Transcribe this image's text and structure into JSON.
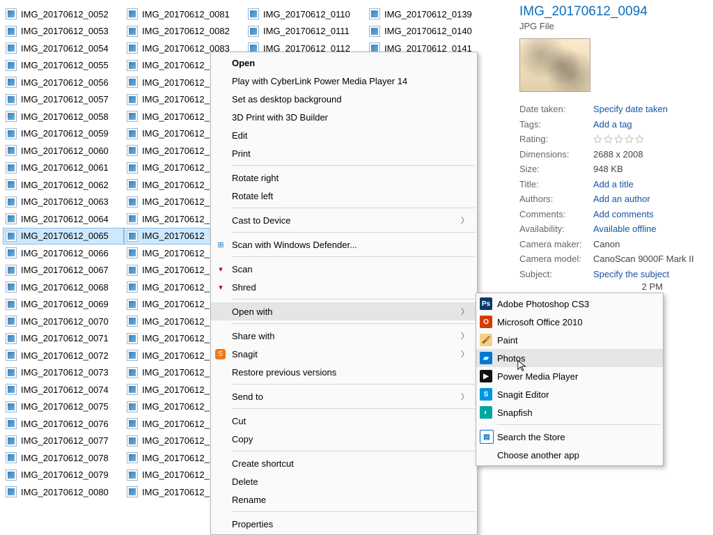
{
  "files": {
    "col1": [
      "IMG_20170612_0052",
      "IMG_20170612_0053",
      "IMG_20170612_0054",
      "IMG_20170612_0055",
      "IMG_20170612_0056",
      "IMG_20170612_0057",
      "IMG_20170612_0058",
      "IMG_20170612_0059",
      "IMG_20170612_0060",
      "IMG_20170612_0061",
      "IMG_20170612_0062",
      "IMG_20170612_0063",
      "IMG_20170612_0064",
      "IMG_20170612_0065",
      "IMG_20170612_0066",
      "IMG_20170612_0067",
      "IMG_20170612_0068",
      "IMG_20170612_0069",
      "IMG_20170612_0070",
      "IMG_20170612_0071",
      "IMG_20170612_0072",
      "IMG_20170612_0073",
      "IMG_20170612_0074",
      "IMG_20170612_0075",
      "IMG_20170612_0076",
      "IMG_20170612_0077",
      "IMG_20170612_0078",
      "IMG_20170612_0079",
      "IMG_20170612_0080"
    ],
    "col2_full": [
      "IMG_20170612_0081",
      "IMG_20170612_0082",
      "IMG_20170612_0083"
    ],
    "col2_trunc": [
      "IMG_20170612_",
      "IMG_20170612_",
      "IMG_20170612_",
      "IMG_20170612_",
      "IMG_20170612_",
      "IMG_20170612_",
      "IMG_20170612_",
      "IMG_20170612_",
      "IMG_20170612_",
      "IMG_20170612_",
      "IMG_20170612",
      "IMG_20170612_",
      "IMG_20170612_",
      "IMG_20170612_",
      "IMG_20170612_",
      "IMG_20170612_",
      "IMG_20170612_",
      "IMG_20170612_",
      "IMG_20170612_",
      "IMG_20170612_",
      "IMG_20170612_",
      "IMG_20170612_",
      "IMG_20170612_",
      "IMG_20170612_",
      "IMG_20170612_",
      "IMG_20170612_"
    ],
    "col3": [
      "IMG_20170612_0110",
      "IMG_20170612_0111",
      "IMG_20170612_0112"
    ],
    "col4": [
      "IMG_20170612_0139",
      "IMG_20170612_0140",
      "IMG_20170612_0141"
    ]
  },
  "selected_file_name": "IMG_20170612_0094",
  "details": {
    "title": "IMG_20170612_0094",
    "type": "JPG File",
    "rows": [
      {
        "label": "Date taken:",
        "value": "Specify date taken",
        "link": true
      },
      {
        "label": "Tags:",
        "value": "Add a tag",
        "link": true
      },
      {
        "label": "Rating:",
        "value": "",
        "stars": true
      },
      {
        "label": "Dimensions:",
        "value": "2688 x 2008"
      },
      {
        "label": "Size:",
        "value": "948 KB"
      },
      {
        "label": "Title:",
        "value": "Add a title",
        "link": true
      },
      {
        "label": "Authors:",
        "value": "Add an author",
        "link": true
      },
      {
        "label": "Comments:",
        "value": "Add comments",
        "link": true
      },
      {
        "label": "Availability:",
        "value": "Available offline",
        "link": true
      },
      {
        "label": "Camera maker:",
        "value": "Canon"
      },
      {
        "label": "Camera model:",
        "value": "CanoScan 9000F Mark II"
      },
      {
        "label": "Subject:",
        "value": "Specify the subject",
        "link": true
      }
    ],
    "pm_trailing": "2 PM"
  },
  "ctx": {
    "open": "Open",
    "play": "Play with CyberLink Power Media Player 14",
    "set_bg": "Set as desktop background",
    "print3d": "3D Print with 3D Builder",
    "edit": "Edit",
    "print": "Print",
    "rotate_r": "Rotate right",
    "rotate_l": "Rotate left",
    "cast": "Cast to Device",
    "defender": "Scan with Windows Defender...",
    "scan": "Scan",
    "shred": "Shred",
    "open_with": "Open with",
    "share": "Share with",
    "snagit": "Snagit",
    "restore": "Restore previous versions",
    "send": "Send to",
    "cut": "Cut",
    "copy": "Copy",
    "shortcut": "Create shortcut",
    "delete": "Delete",
    "rename": "Rename",
    "properties": "Properties"
  },
  "openwith": {
    "ps": "Adobe Photoshop CS3",
    "office": "Microsoft Office 2010",
    "paint": "Paint",
    "photos": "Photos",
    "pmp": "Power Media Player",
    "snaged": "Snagit Editor",
    "snapfish": "Snapfish",
    "store": "Search the Store",
    "choose": "Choose another app"
  }
}
